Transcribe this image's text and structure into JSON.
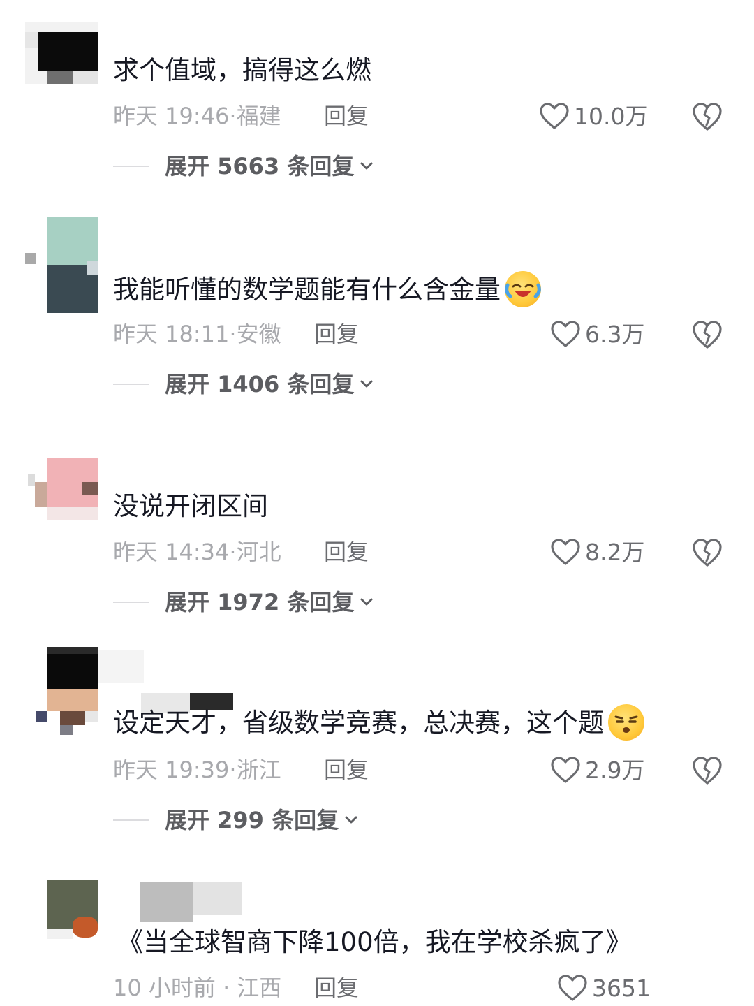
{
  "comments": [
    {
      "text": "求个值域，搞得这么燃",
      "time": "昨天 19:46",
      "location": "福建",
      "reply_label": "回复",
      "likes": "10.0万",
      "expand_label": "展开 5663 条回复"
    },
    {
      "text": "我能听懂的数学题能有什么含金量",
      "emoji": "laughing-crying-emoji",
      "time": "昨天 18:11",
      "location": "安徽",
      "reply_label": "回复",
      "likes": "6.3万",
      "expand_label": "展开 1406 条回复"
    },
    {
      "text": "没说开闭区间",
      "time": "昨天 14:34",
      "location": "河北",
      "reply_label": "回复",
      "likes": "8.2万",
      "expand_label": "展开 1972 条回复"
    },
    {
      "text": "设定天才，省级数学竞赛，总决赛，这个题",
      "emoji": "smug-face-emoji",
      "time": "昨天 19:39",
      "location": "浙江",
      "reply_label": "回复",
      "likes": "2.9万",
      "expand_label": "展开 299 条回复"
    },
    {
      "text": "《当全球智商下降100倍，我在学校杀疯了》",
      "time": "10 小时前",
      "location": "江西",
      "reply_label": "回复",
      "likes": "3651"
    }
  ],
  "colors": {
    "text": "#161823",
    "meta": "#a8a9ad",
    "action": "#6b6c70"
  }
}
